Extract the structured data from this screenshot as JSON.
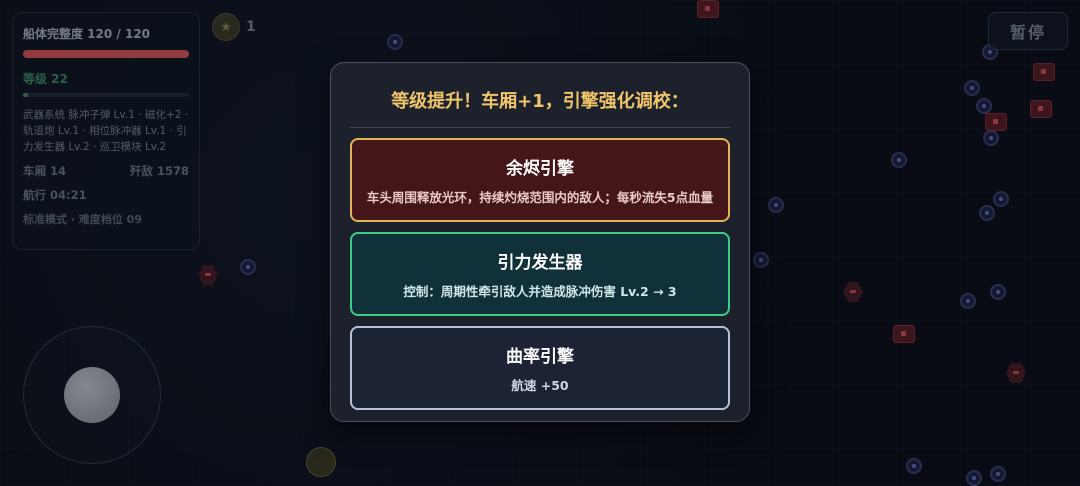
{
  "hud": {
    "hull_label": "船体完整度 120 / 120",
    "hull_fraction": 1.0,
    "level_label": "等级 22",
    "xp_fraction": 0.03,
    "weapons_text": "武器系统 脉冲子弹 Lv.1 · 磁化+2 · 轨道炮 Lv.1 · 相位脉冲器 Lv.1 · 引力发生器 Lv.2 · 巡卫模块 Lv.2",
    "carriages": "车厢 14",
    "kills": "歼敌 1578",
    "voyage": "航行 04:21",
    "mode": "标准模式 · 难度档位 09"
  },
  "coins": {
    "icon": "star-icon",
    "count": "1"
  },
  "pause": {
    "label": "暂停"
  },
  "modal": {
    "title": "等级提升！车厢+1，引擎强化调校：",
    "options": [
      {
        "name": "余烬引擎",
        "desc": "车头周围释放光环，持续灼烧范围内的敌人；每秒流失5点血量",
        "accent": "#e3b35a"
      },
      {
        "name": "引力发生器",
        "desc": "控制：周期性牵引敌人并造成脉冲伤害 Lv.2 → 3",
        "accent": "#3ccd85"
      },
      {
        "name": "曲率引擎",
        "desc": "航速 +50",
        "accent": "#b8c2d6"
      }
    ]
  }
}
